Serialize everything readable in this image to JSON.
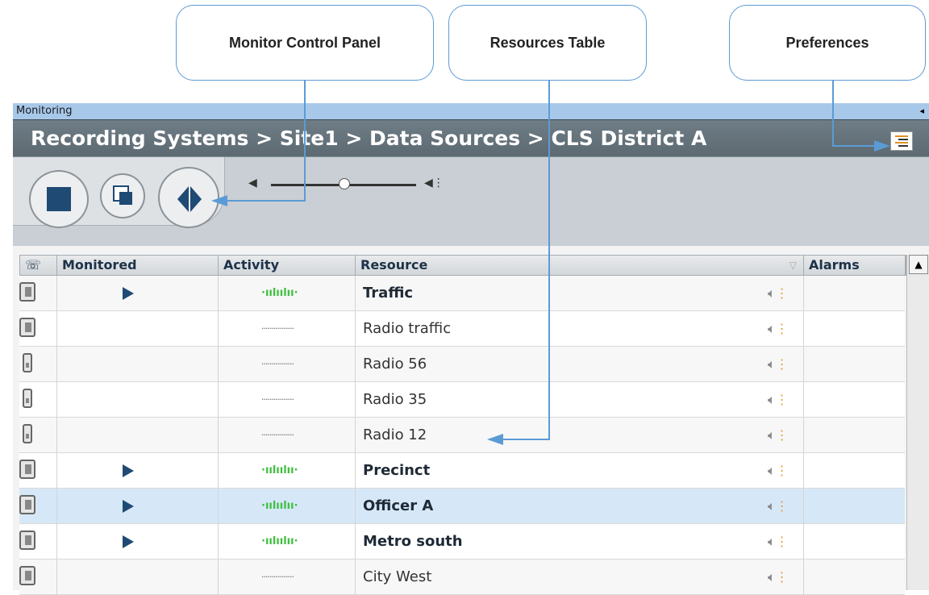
{
  "callouts": {
    "monitor_control_panel": "Monitor Control Panel",
    "resources_table": "Resources Table",
    "preferences": "Preferences"
  },
  "panel": {
    "title": "Monitoring",
    "breadcrumb": "Recording Systems > Site1 > Data Sources > CLS District A",
    "preferences_icon": "list-settings-icon"
  },
  "controls": {
    "stop_icon": "stop-icon",
    "copy_icon": "copy-icon",
    "monitor_icon": "monitor-icon",
    "volume_level": 0.5
  },
  "table": {
    "headers": {
      "phone": "",
      "monitored": "Monitored",
      "activity": "Activity",
      "resource": "Resource",
      "alarms": "Alarms"
    },
    "rows": [
      {
        "type": "desk",
        "monitored": true,
        "active": true,
        "resource": "Traffic",
        "bold": true
      },
      {
        "type": "desk",
        "monitored": false,
        "active": false,
        "resource": "Radio traffic",
        "bold": false
      },
      {
        "type": "radio",
        "monitored": false,
        "active": false,
        "resource": "Radio 56",
        "bold": false
      },
      {
        "type": "radio",
        "monitored": false,
        "active": false,
        "resource": "Radio 35",
        "bold": false
      },
      {
        "type": "radio",
        "monitored": false,
        "active": false,
        "resource": "Radio 12",
        "bold": false
      },
      {
        "type": "desk",
        "monitored": true,
        "active": true,
        "resource": "Precinct",
        "bold": true
      },
      {
        "type": "desk",
        "monitored": true,
        "active": true,
        "resource": "Officer A",
        "bold": true,
        "selected": true
      },
      {
        "type": "desk",
        "monitored": true,
        "active": true,
        "resource": "Metro south",
        "bold": true
      },
      {
        "type": "desk",
        "monitored": false,
        "active": false,
        "resource": "City West",
        "bold": false
      }
    ]
  },
  "colors": {
    "accent": "#5b9bd5",
    "brand_dark": "#1f4a74",
    "active_wave": "#3fbf3f"
  }
}
